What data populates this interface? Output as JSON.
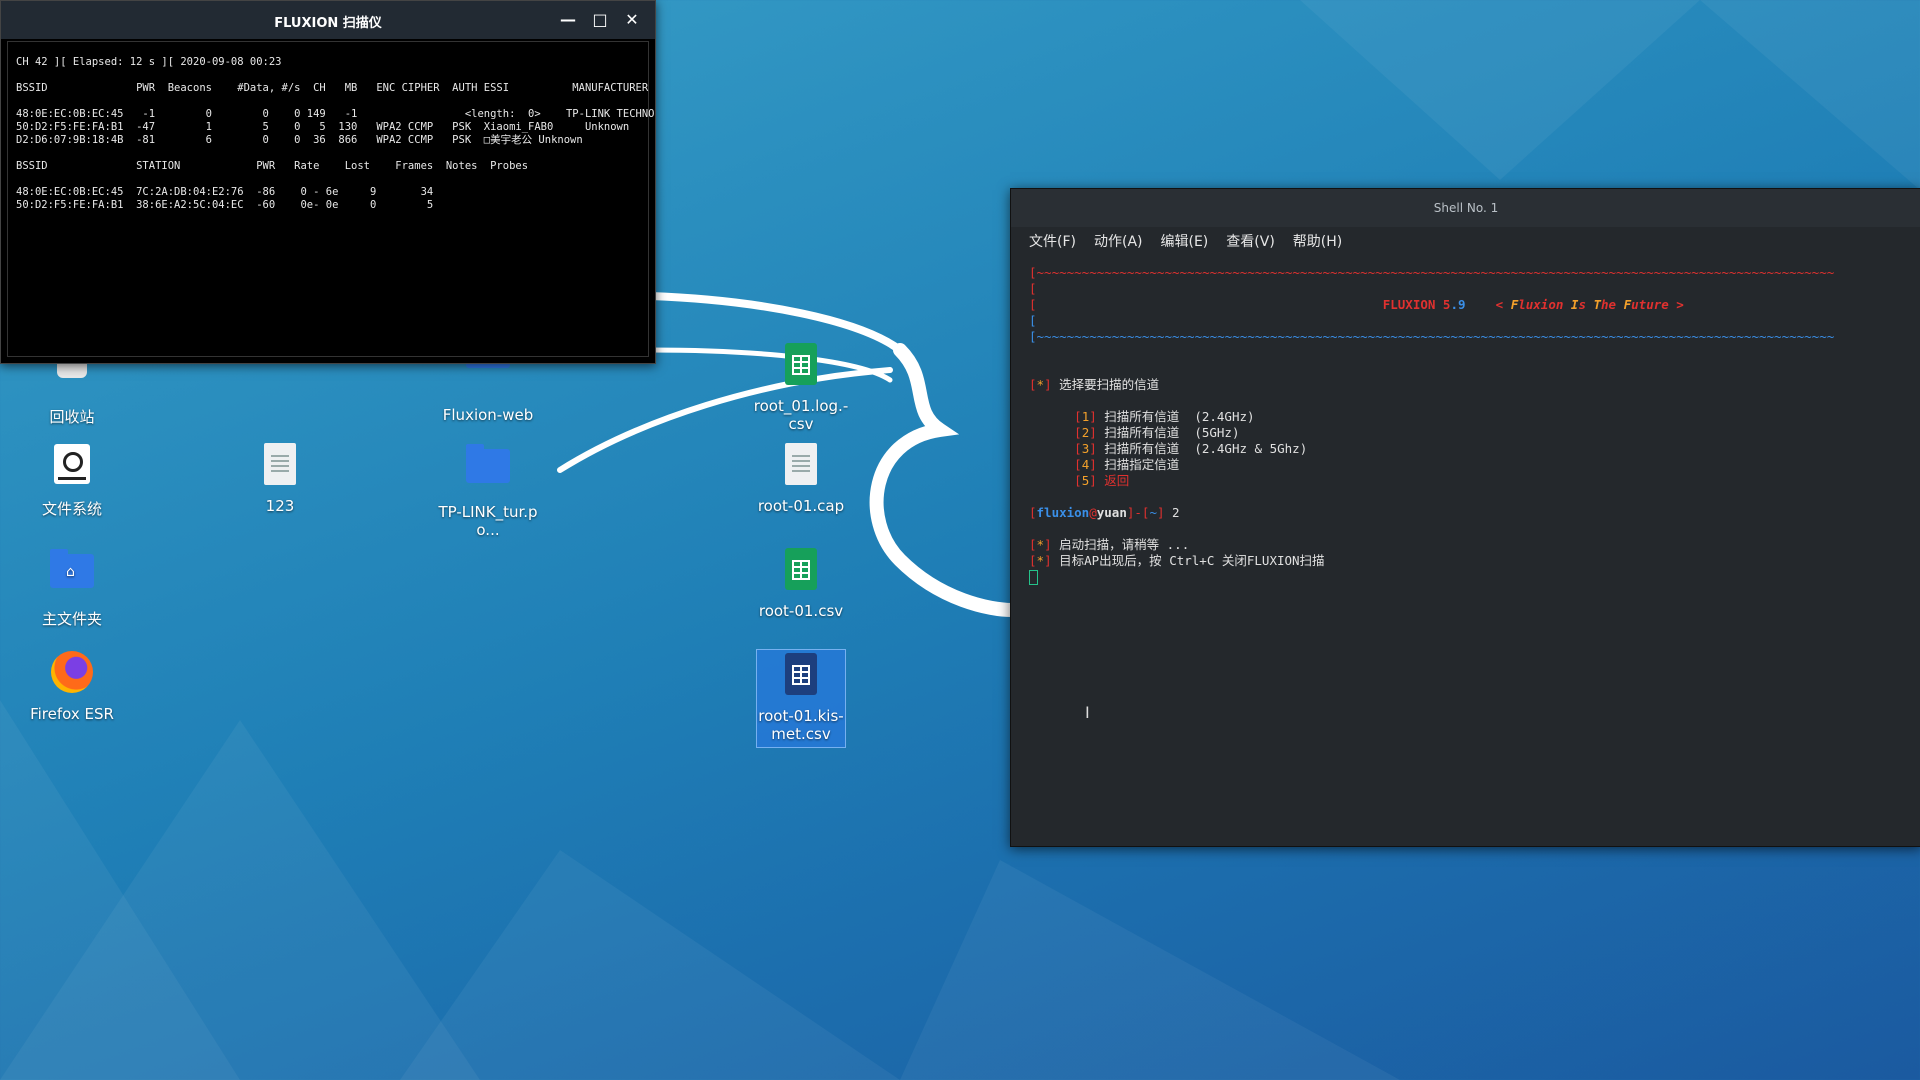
{
  "desktop": {
    "icons": [
      {
        "label": "回收站"
      },
      {
        "label": "文件系统"
      },
      {
        "label": "主文件夹"
      },
      {
        "label": "Firefox ESR"
      },
      {
        "label": "123"
      },
      {
        "label": "Fluxion-web"
      },
      {
        "label": "TP-LINK_tur.po..."
      },
      {
        "label": "root_01.log.-csv"
      },
      {
        "label": "root-01.cap"
      },
      {
        "label": "root-01.csv"
      },
      {
        "label": "root-01.kis-met.csv"
      }
    ]
  },
  "scanner": {
    "title": "FLUXION 扫描仪",
    "status_line": "CH 42 ][ Elapsed: 12 s ][ 2020-09-08 00:23",
    "ap_header": "BSSID              PWR  Beacons    #Data, #/s  CH   MB   ENC CIPHER  AUTH ESSI          MANUFACTURER",
    "ap_rows": [
      "48:0E:EC:0B:EC:45   -1        0        0    0 149   -1                 <length:  0>    TP-LINK TECHNO",
      "50:D2:F5:FE:FA:B1  -47        1        5    0   5  130   WPA2 CCMP   PSK  Xiaomi_FAB0     Unknown",
      "D2:D6:07:9B:18:4B  -81        6        0    0  36  866   WPA2 CCMP   PSK  □美宇老公 Unknown"
    ],
    "station_header": "BSSID              STATION            PWR   Rate    Lost    Frames  Notes  Probes",
    "station_rows": [
      "48:0E:EC:0B:EC:45  7C:2A:DB:04:E2:76  -86    0 - 6e     9       34",
      "50:D2:F5:FE:FA:B1  38:6E:A2:5C:04:EC  -60    0e- 0e     0        5"
    ]
  },
  "shell": {
    "title": "Shell No. 1",
    "menu": [
      "文件(F)",
      "动作(A)",
      "编辑(E)",
      "查看(V)",
      "帮助(H)"
    ],
    "banner_name": "FLUXION 5",
    "banner_version": ".9",
    "banner_slogan_open": "< ",
    "banner_slogan_f": "F",
    "banner_slogan_1": "luxion ",
    "banner_slogan_i": "I",
    "banner_slogan_2": "s ",
    "banner_slogan_t": "T",
    "banner_slogan_3": "he ",
    "banner_slogan_fu": "F",
    "banner_slogan_4": "uture >",
    "prompt_select": "选择要扫描的信道",
    "options": [
      {
        "num": "1",
        "text": "扫描所有信道  (2.4GHz)"
      },
      {
        "num": "2",
        "text": "扫描所有信道  (5GHz)"
      },
      {
        "num": "3",
        "text": "扫描所有信道  (2.4GHz & 5Ghz)"
      },
      {
        "num": "4",
        "text": "扫描指定信道"
      },
      {
        "num": "5",
        "text": "返回"
      }
    ],
    "user": "fluxion",
    "host": "yuan",
    "path": "~",
    "input": "2",
    "msg1": "启动扫描，请稍等 ...",
    "msg2": "目标AP出现后，按 Ctrl+C 关闭FLUXION扫描"
  },
  "colors": {
    "accent_red": "#e0312f",
    "accent_blue": "#3a8fe8",
    "accent_orange": "#f2a02b"
  }
}
